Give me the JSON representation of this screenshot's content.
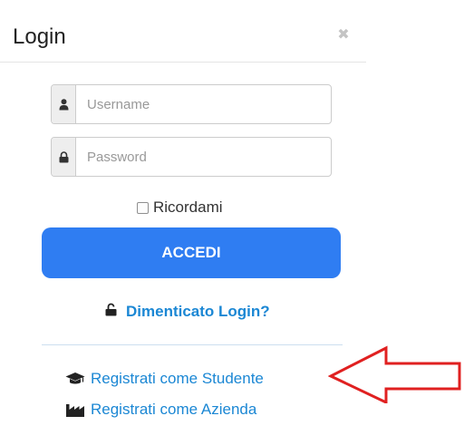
{
  "dialog": {
    "title": "Login",
    "close_glyph": "✖"
  },
  "form": {
    "username_placeholder": "Username",
    "password_placeholder": "Password",
    "remember_label": "Ricordami",
    "submit_label": "ACCEDI"
  },
  "links": {
    "forgot": "Dimenticato Login?",
    "register_student": "Registrati come Studente",
    "register_company": "Registrati come Azienda"
  },
  "icons": {
    "username": "user-icon",
    "password": "lock-icon",
    "forgot": "unlock-icon",
    "student": "graduation-cap-icon",
    "company": "industry-icon"
  },
  "colors": {
    "primary_button": "#2f7df2",
    "link": "#1b87d4",
    "annotation_arrow": "#e02020"
  }
}
